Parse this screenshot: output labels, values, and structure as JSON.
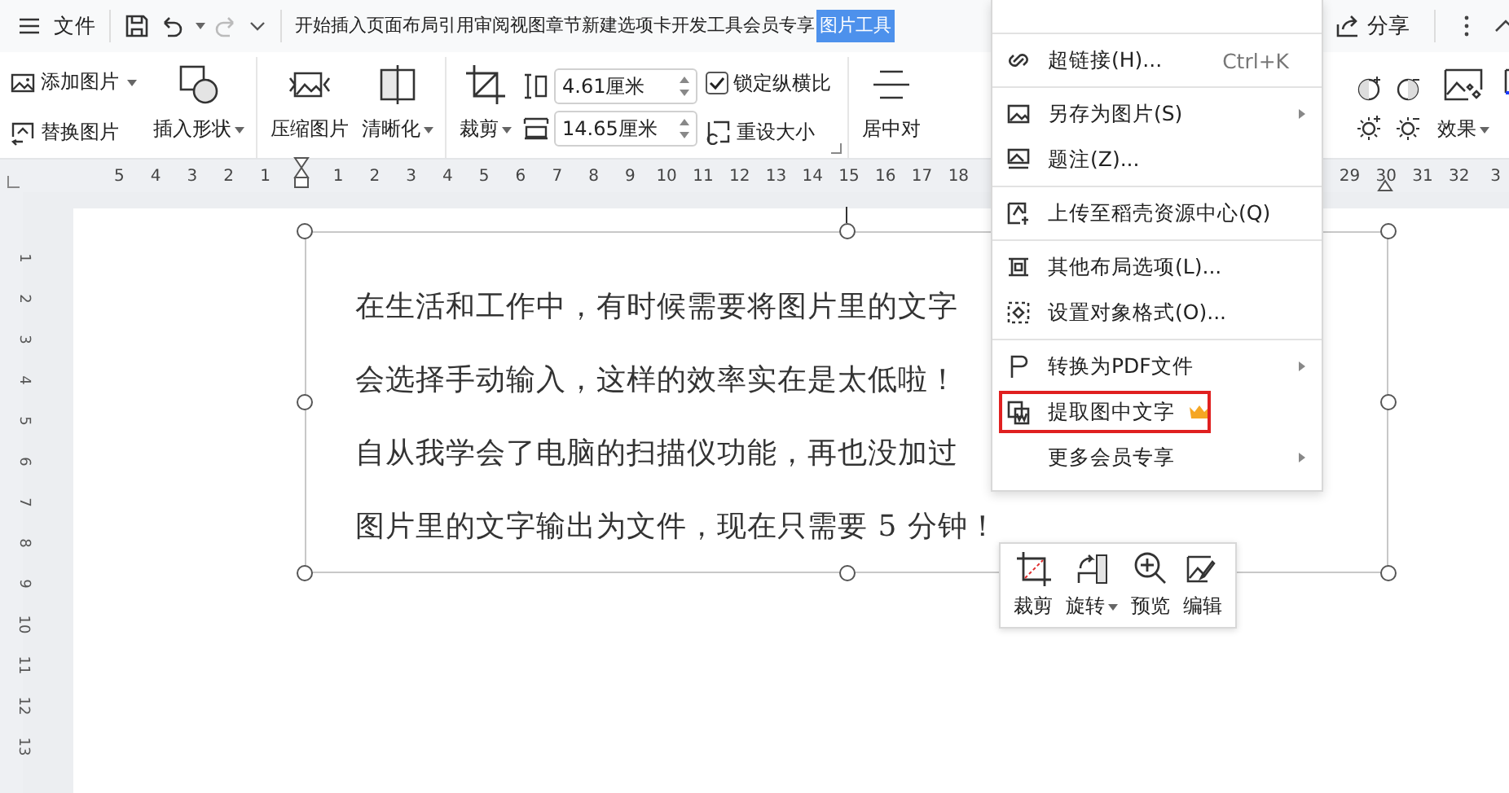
{
  "topbar": {
    "menu_label": "文件",
    "tabs": [
      {
        "label": "开始",
        "selected": false
      },
      {
        "label": "插入",
        "selected": false
      },
      {
        "label": "页面布局",
        "selected": false
      },
      {
        "label": "引用",
        "selected": false
      },
      {
        "label": "审阅",
        "selected": false
      },
      {
        "label": "视图",
        "selected": false
      },
      {
        "label": "章节",
        "selected": false
      },
      {
        "label": "新建选项卡",
        "selected": false
      },
      {
        "label": "开发工具",
        "selected": false
      },
      {
        "label": "会员专享",
        "selected": false
      },
      {
        "label": "图片工具",
        "selected": true
      }
    ],
    "share_label": "分享"
  },
  "ribbon": {
    "add_picture": {
      "label": "添加图片",
      "dropdown": true
    },
    "replace_picture": {
      "label": "替换图片",
      "dropdown": false
    },
    "insert_shape": {
      "label": "插入形状",
      "dropdown": true
    },
    "compress": {
      "label": "压缩图片",
      "dropdown": false
    },
    "sharpen": {
      "label": "清晰化",
      "dropdown": true
    },
    "crop": {
      "label": "裁剪",
      "dropdown": true
    },
    "height_field": {
      "value": "4.61厘米"
    },
    "width_field": {
      "value": "14.65厘米"
    },
    "lock_ratio": {
      "label": "锁定纵横比",
      "checked": true
    },
    "reset_size": {
      "label": "重设大小"
    },
    "align_center": {
      "label": "居中对"
    },
    "effects": {
      "label": "效果",
      "dropdown": true
    }
  },
  "ruler": {
    "left_numbers": [
      "5",
      "4",
      "3",
      "2",
      "1"
    ],
    "numbers": [
      "1",
      "2",
      "3",
      "4",
      "5",
      "6",
      "7",
      "8",
      "9",
      "10",
      "11",
      "12",
      "13",
      "14",
      "15",
      "16",
      "17",
      "18"
    ],
    "right_numbers": [
      "29",
      "30",
      "31",
      "32",
      "3"
    ],
    "vertical_numbers": [
      "1",
      "2",
      "3",
      "4",
      "5",
      "6",
      "7",
      "8",
      "9",
      "10",
      "11",
      "12",
      "13"
    ]
  },
  "document": {
    "lines": [
      "在生活和工作中，有时候需要将图片里的文字",
      "会选择手动输入，这样的效率实在是太低啦！",
      "自从我学会了电脑的扫描仪功能，再也没加过",
      "图片里的文字输出为文件，现在只需要 5 分钟！"
    ]
  },
  "context_menu": {
    "groups": [
      [
        {
          "label": "超链接(H)...",
          "shortcut": "Ctrl+K",
          "submenu": false,
          "highlighted": false,
          "premium": false
        }
      ],
      [
        {
          "label": "另存为图片(S)",
          "submenu": true,
          "highlighted": false,
          "premium": false
        },
        {
          "label": "题注(Z)...",
          "submenu": false,
          "highlighted": false,
          "premium": false
        }
      ],
      [
        {
          "label": "上传至稻壳资源中心(Q)",
          "submenu": false,
          "highlighted": false,
          "premium": false
        }
      ],
      [
        {
          "label": "其他布局选项(L)...",
          "submenu": false,
          "highlighted": false,
          "premium": false
        },
        {
          "label": "设置对象格式(O)...",
          "submenu": false,
          "highlighted": false,
          "premium": false
        }
      ],
      [
        {
          "label": "转换为PDF文件",
          "submenu": true,
          "highlighted": false,
          "premium": false
        },
        {
          "label": "提取图中文字",
          "submenu": false,
          "highlighted": true,
          "premium": true
        },
        {
          "label": "更多会员专享",
          "submenu": true,
          "highlighted": false,
          "premium": false
        }
      ]
    ]
  },
  "mini_toolbar": [
    {
      "label": "裁剪",
      "dropdown": false
    },
    {
      "label": "旋转",
      "dropdown": true
    },
    {
      "label": "预览",
      "dropdown": false
    },
    {
      "label": "编辑",
      "dropdown": false
    }
  ]
}
